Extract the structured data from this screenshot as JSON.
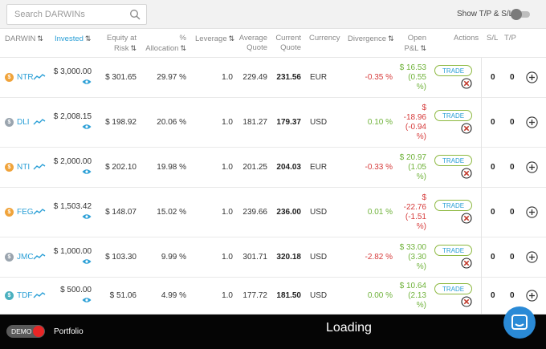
{
  "search": {
    "placeholder": "Search DARWINs"
  },
  "toggle": {
    "label": "Show T/P & S/L",
    "on": false
  },
  "columns": {
    "darwin": "DARWIN",
    "invested": "Invested",
    "equity_line1": "Equity at",
    "equity_line2": "Risk",
    "alloc_line1": "%",
    "alloc_line2": "Allocation",
    "leverage": "Leverage",
    "avg_line1": "Average",
    "avg_line2": "Quote",
    "cur_line1": "Current",
    "cur_line2": "Quote",
    "currency": "Currency",
    "divergence": "Divergence",
    "pnl_line1": "Open",
    "pnl_line2": "P&L",
    "actions": "Actions",
    "sl": "S/L",
    "tp": "T/P",
    "sort_glyph": "⇅"
  },
  "rows": [
    {
      "name": "NTR",
      "icon": "dollar-coin-icon",
      "icon_color": "#f0a33a",
      "invested": "$ 3,000.00",
      "equity": "$ 301.65",
      "allocation": "29.97 %",
      "leverage": "1.0",
      "avg_quote": "229.49",
      "current_quote": "231.56",
      "currency": "EUR",
      "divergence": "-0.35 %",
      "divergence_sign": "neg",
      "pnl_lines": [
        "$ 16.53",
        "(0.55",
        "%)"
      ],
      "pnl_sign": "pos",
      "trade": "TRADE",
      "sl": "0",
      "tp": "0"
    },
    {
      "name": "DLI",
      "icon": "dollar-coin-icon",
      "icon_color": "#9aa4ae",
      "invested": "$ 2,008.15",
      "equity": "$ 198.92",
      "allocation": "20.06 %",
      "leverage": "1.0",
      "avg_quote": "181.27",
      "current_quote": "179.37",
      "currency": "USD",
      "divergence": "0.10 %",
      "divergence_sign": "pos",
      "pnl_lines": [
        "$",
        "-18.96",
        "(-0.94",
        "%)"
      ],
      "pnl_sign": "neg",
      "trade": "TRADE",
      "sl": "0",
      "tp": "0"
    },
    {
      "name": "NTI",
      "icon": "dollar-coin-icon",
      "icon_color": "#f0a33a",
      "invested": "$ 2,000.00",
      "equity": "$ 202.10",
      "allocation": "19.98 %",
      "leverage": "1.0",
      "avg_quote": "201.25",
      "current_quote": "204.03",
      "currency": "EUR",
      "divergence": "-0.33 %",
      "divergence_sign": "neg",
      "pnl_lines": [
        "$ 20.97",
        "(1.05",
        "%)"
      ],
      "pnl_sign": "pos",
      "trade": "TRADE",
      "sl": "0",
      "tp": "0"
    },
    {
      "name": "FEG",
      "icon": "dollar-coin-icon",
      "icon_color": "#f0a33a",
      "invested": "$ 1,503.42",
      "equity": "$ 148.07",
      "allocation": "15.02 %",
      "leverage": "1.0",
      "avg_quote": "239.66",
      "current_quote": "236.00",
      "currency": "USD",
      "divergence": "0.01 %",
      "divergence_sign": "pos",
      "pnl_lines": [
        "$",
        "-22.76",
        "(-1.51",
        "%)"
      ],
      "pnl_sign": "neg",
      "trade": "TRADE",
      "sl": "0",
      "tp": "0"
    },
    {
      "name": "JMC",
      "icon": "dollar-coin-icon",
      "icon_color": "#9aa4ae",
      "invested": "$ 1,000.00",
      "equity": "$ 103.30",
      "allocation": "9.99 %",
      "leverage": "1.0",
      "avg_quote": "301.71",
      "current_quote": "320.18",
      "currency": "USD",
      "divergence": "-2.82 %",
      "divergence_sign": "neg",
      "pnl_lines": [
        "$ 33.00",
        "(3.30",
        "%)"
      ],
      "pnl_sign": "pos",
      "trade": "TRADE",
      "sl": "0",
      "tp": "0"
    },
    {
      "name": "TDF",
      "icon": "dollar-coin-icon",
      "icon_color": "#4ab0bf",
      "invested": "$ 500.00",
      "equity": "$ 51.06",
      "allocation": "4.99 %",
      "leverage": "1.0",
      "avg_quote": "177.72",
      "current_quote": "181.50",
      "currency": "USD",
      "divergence": "0.00 %",
      "divergence_sign": "pos",
      "pnl_lines": [
        "$ 10.64",
        "(2.13",
        "%)"
      ],
      "pnl_sign": "pos",
      "trade": "TRADE",
      "sl": "0",
      "tp": "0"
    }
  ],
  "footer": {
    "demo": "DEMO",
    "portfolio": "Portfolio",
    "loading": "Loading"
  },
  "colors": {
    "accent": "#2a9fd6",
    "positive": "#6fb23a",
    "negative": "#d63b3b",
    "trade_border": "#8cb83f",
    "close": "#c0392b"
  }
}
